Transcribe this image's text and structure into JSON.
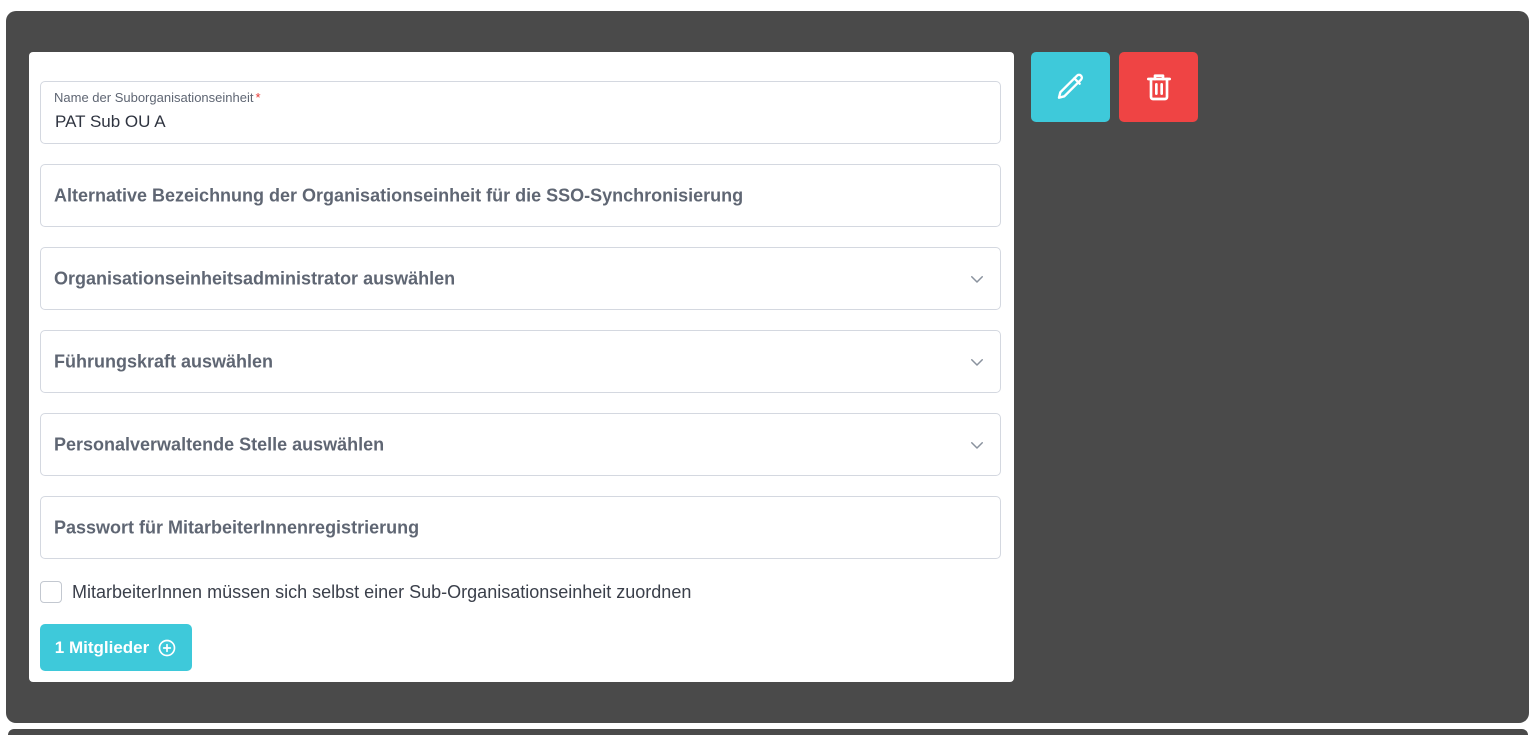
{
  "form": {
    "name_field": {
      "label": "Name der Suborganisationseinheit",
      "required_mark": "*",
      "value": "PAT Sub OU A"
    },
    "sso_field": {
      "placeholder": "Alternative Bezeichnung der Organisationseinheit für die SSO-Synchronisierung"
    },
    "admin_select": {
      "placeholder": "Organisationseinheitsadministrator auswählen"
    },
    "manager_select": {
      "placeholder": "Führungskraft auswählen"
    },
    "hr_select": {
      "placeholder": "Personalverwaltende Stelle auswählen"
    },
    "password_field": {
      "placeholder": "Passwort für MitarbeiterInnenregistrierung"
    },
    "self_assign_checkbox": {
      "label": "MitarbeiterInnen müssen sich selbst einer Sub-Organisationseinheit zuordnen",
      "checked": false
    },
    "members_button": {
      "label": "1 Mitglieder",
      "icon": "plus-circle-icon"
    }
  },
  "actions": {
    "edit": {
      "icon": "pencil-icon",
      "color": "#3ec9da"
    },
    "delete": {
      "icon": "trash-icon",
      "color": "#ef4444"
    }
  },
  "colors": {
    "panel_background": "#4a4a4a",
    "accent": "#3ec9da",
    "danger": "#ef4444"
  }
}
